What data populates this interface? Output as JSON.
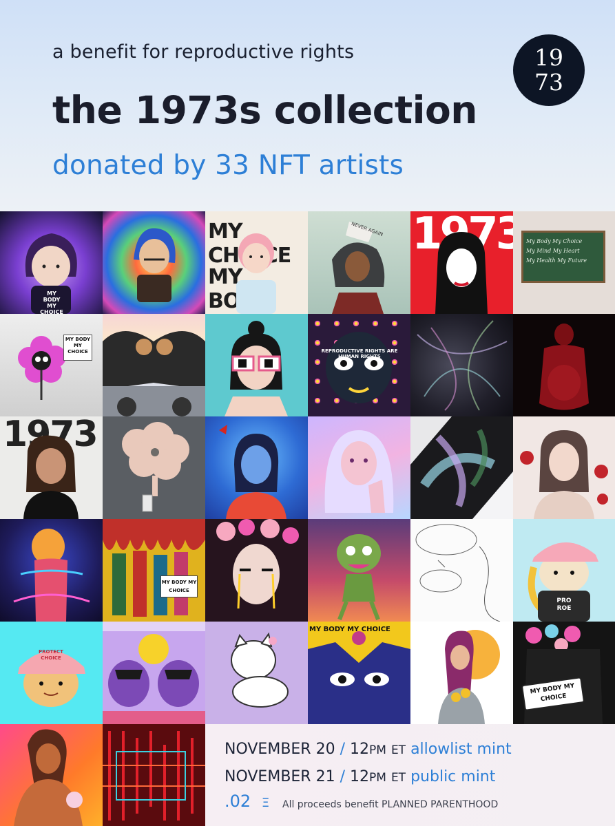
{
  "header": {
    "subtitle": "a benefit for reproductive rights",
    "title": "the 1973s collection",
    "tagline": "donated by 33 NFT artists",
    "logo_line1": "19",
    "logo_line2": "73"
  },
  "artworks": {
    "count": 33,
    "labels": {
      "tile1": "MY BODY MY CHOICE",
      "tile3a": "MY CHOICE",
      "tile3b": "MY BODY",
      "tile4": "NEVER AGAIN",
      "tile5": "1973",
      "tile6_line1": "My Body My Choice",
      "tile6_line2": "My Mind My Heart",
      "tile6_line3": "My Health My Future",
      "tile7": "MY BODY MY CHOICE",
      "tile10": "REPRODUCTIVE RIGHTS ARE HUMAN RIGHTS",
      "tile13": "1973",
      "tile20": "MY BODY MY CHOICE",
      "tile24": "PRO ROE",
      "tile25": "PROTECT CHOICE",
      "tile28": "MY BODY MY CHOICE",
      "tile30": "MY BODY MY CHOICE"
    }
  },
  "mint": {
    "line1_date": "NOVEMBER 20",
    "line1_time": "12",
    "line1_unit": "PM",
    "line1_tz": "ET",
    "line1_kind": "allowlist mint",
    "line2_date": "NOVEMBER 21",
    "line2_time": "12",
    "line2_unit": "PM",
    "line2_tz": "ET",
    "line2_kind": "public mint",
    "separator": "/",
    "price": ".02",
    "currency_symbol": "Ξ",
    "proceeds": "All proceeds benefit PLANNED PARENTHOOD"
  },
  "colors": {
    "accent_blue": "#2d7fd6",
    "dark_text": "#1a1d2b",
    "logo_bg": "#0d1525"
  }
}
